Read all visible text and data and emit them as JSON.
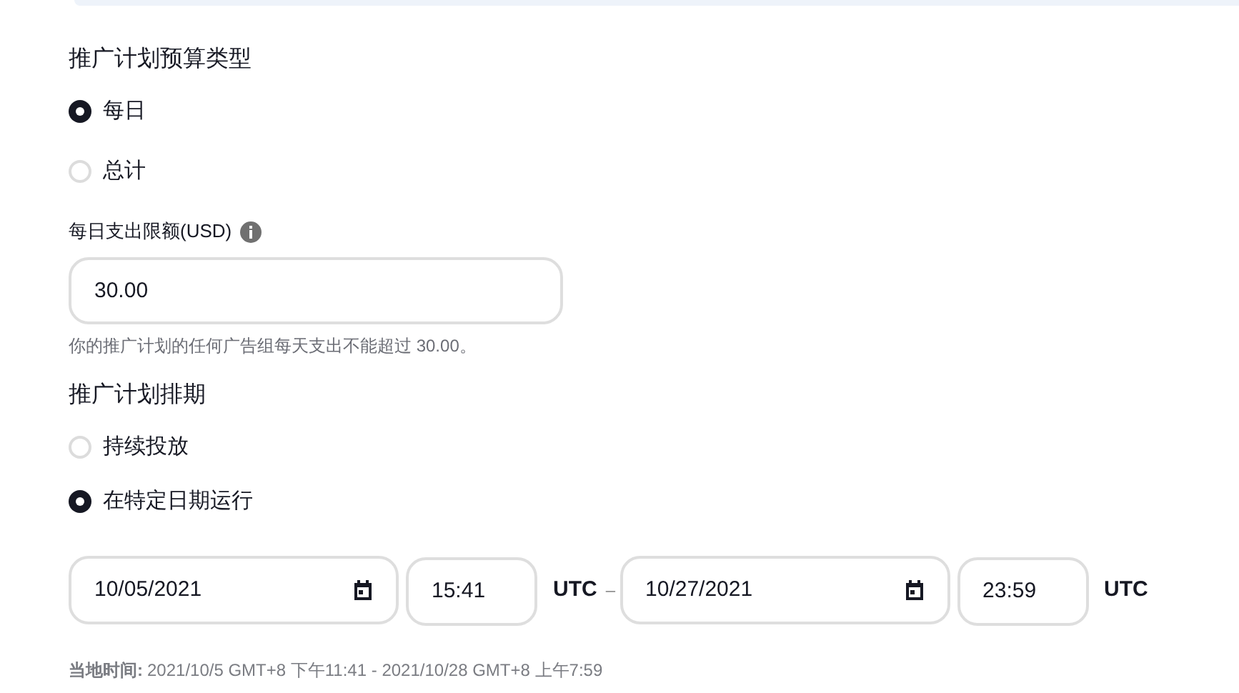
{
  "budget_type": {
    "title": "推广计划预算类型",
    "options": [
      {
        "label": "每日",
        "selected": true
      },
      {
        "label": "总计",
        "selected": false
      }
    ]
  },
  "daily_limit": {
    "label": "每日支出限额(USD)",
    "value": "30.00",
    "help": "你的推广计划的任何广告组每天支出不能超过 30.00。"
  },
  "schedule": {
    "title": "推广计划排期",
    "options": [
      {
        "label": "持续投放",
        "selected": false
      },
      {
        "label": "在特定日期运行",
        "selected": true
      }
    ]
  },
  "range": {
    "start_date": "10/05/2021",
    "start_time": "15:41",
    "start_tz": "UTC",
    "separator": "–",
    "end_date": "10/27/2021",
    "end_time": "23:59",
    "end_tz": "UTC"
  },
  "local_time": {
    "label": "当地时间:",
    "value": "2021/10/5 GMT+8 下午11:41 - 2021/10/28 GMT+8 上午7:59"
  }
}
